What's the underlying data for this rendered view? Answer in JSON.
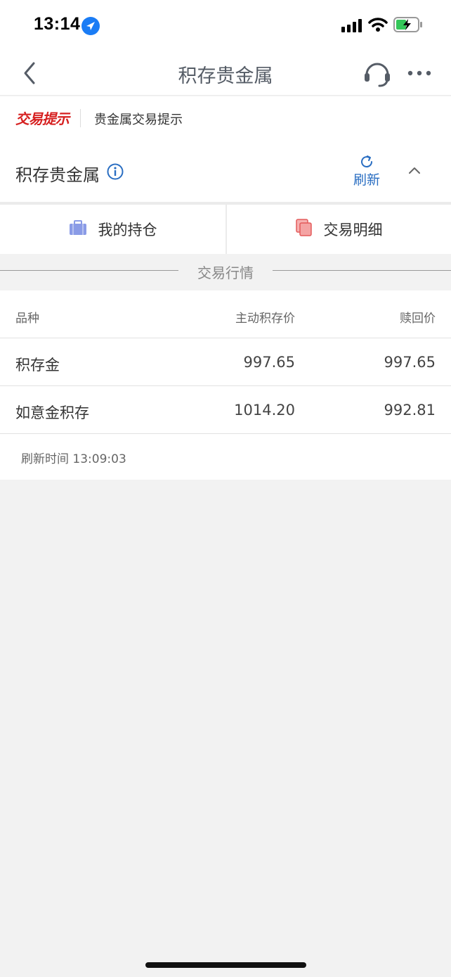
{
  "status_bar": {
    "time": "13:14"
  },
  "nav": {
    "title": "积存贵金属"
  },
  "notice": {
    "tag": "交易提示",
    "text": "贵金属交易提示"
  },
  "section": {
    "heading": "积存贵金属",
    "refresh_label": "刷新"
  },
  "tabs": [
    {
      "label": "我的持仓",
      "icon": "briefcase-icon"
    },
    {
      "label": "交易明细",
      "icon": "copy-icon"
    }
  ],
  "market": {
    "label": "交易行情"
  },
  "table": {
    "headers": [
      "品种",
      "主动积存价",
      "赎回价"
    ],
    "rows": [
      {
        "name": "积存金",
        "deposit_price": "997.65",
        "redeem_price": "997.65"
      },
      {
        "name": "如意金积存",
        "deposit_price": "1014.20",
        "redeem_price": "992.81"
      }
    ],
    "refresh_time": "刷新时间 13:09:03"
  },
  "colors": {
    "accent_blue": "#2a6ec2",
    "notice_red": "#d62020",
    "battery_green": "#34c759"
  }
}
